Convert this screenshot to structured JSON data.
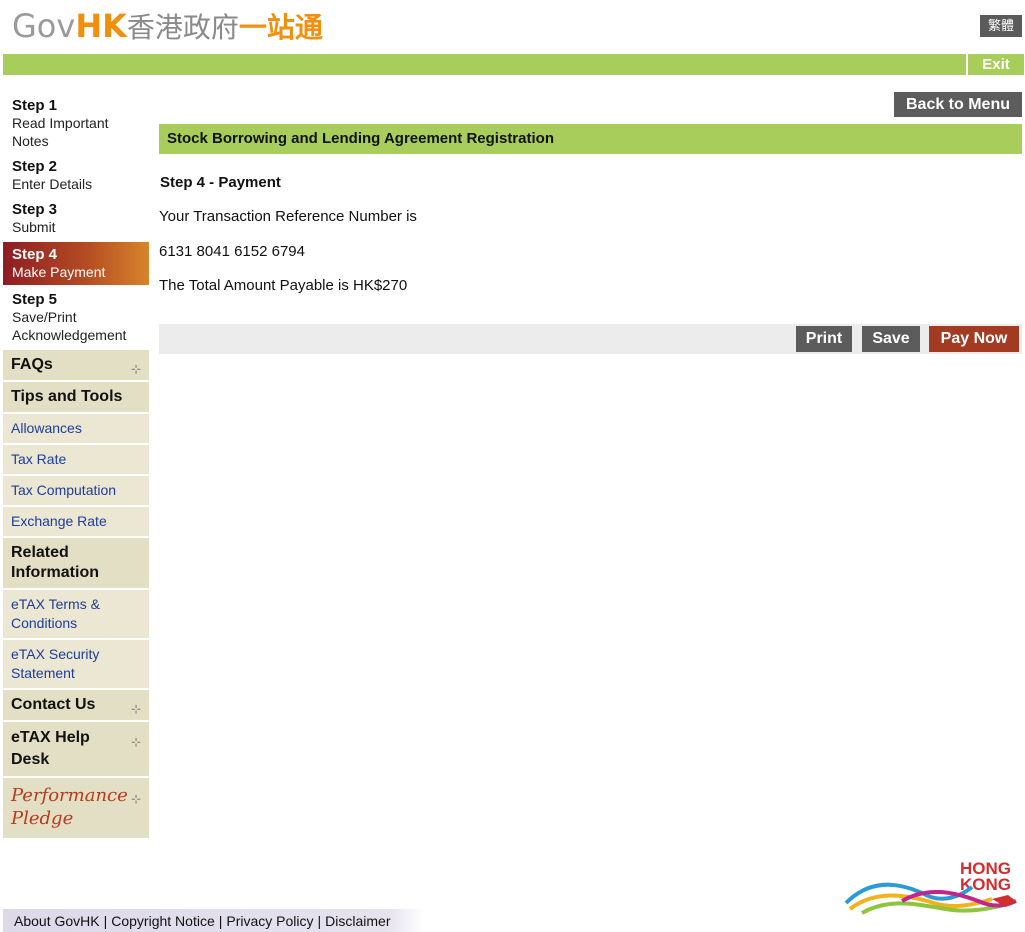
{
  "header": {
    "logo_gov": "Gov",
    "logo_hk": "HK",
    "logo_cn1": "香港政府",
    "logo_cn2": "一站通",
    "lang_button": "繁體",
    "exit_label": "Exit"
  },
  "sidebar": {
    "steps": [
      {
        "num": "Step 1",
        "label1": "Read Important",
        "label2": "Notes"
      },
      {
        "num": "Step 2",
        "label1": "Enter Details",
        "label2": ""
      },
      {
        "num": "Step 3",
        "label1": "Submit",
        "label2": ""
      },
      {
        "num": "Step 4",
        "label1": "Make Payment",
        "label2": ""
      },
      {
        "num": "Step 5",
        "label1": "Save/Print",
        "label2": "Acknowledgement"
      }
    ],
    "faqs": "FAQs",
    "tips_tools": "Tips and Tools",
    "tips_links": [
      "Allowances",
      "Tax Rate",
      "Tax Computation",
      "Exchange Rate"
    ],
    "related_info_1": "Related",
    "related_info_2": "Information",
    "related_links": [
      {
        "line1": "eTAX Terms &",
        "line2": "Conditions"
      },
      {
        "line1": "eTAX Security",
        "line2": "Statement"
      }
    ],
    "contact_us": "Contact Us",
    "help_desk_1": "eTAX Help",
    "help_desk_2": "Desk",
    "pledge_1": "Performance",
    "pledge_2": "Pledge",
    "plus_glyph": "⊹"
  },
  "main": {
    "back_to_menu": "Back to Menu",
    "page_title": "Stock Borrowing and Lending Agreement Registration",
    "step_title": "Step 4 - Payment",
    "ref_label": "Your Transaction Reference Number is",
    "ref_number": "6131 8041 6152 6794",
    "amount_text": "The Total Amount Payable is HK$270",
    "print_label": "Print",
    "save_label": "Save",
    "pay_label": "Pay Now"
  },
  "footer": {
    "about": "About GovHK",
    "copyright": "Copyright Notice",
    "privacy": "Privacy Policy",
    "disclaimer": "Disclaimer",
    "separator": "|",
    "hk_logo_line1": "HONG",
    "hk_logo_line2": "KONG"
  },
  "colors": {
    "green": "#a9cd5a",
    "brand_orange": "#f0900e",
    "pay_red": "#a33a22",
    "dark_button": "#5c5c5c",
    "sidebar_beige": "#e3dfc4",
    "link_blue": "#1c3d9a"
  }
}
